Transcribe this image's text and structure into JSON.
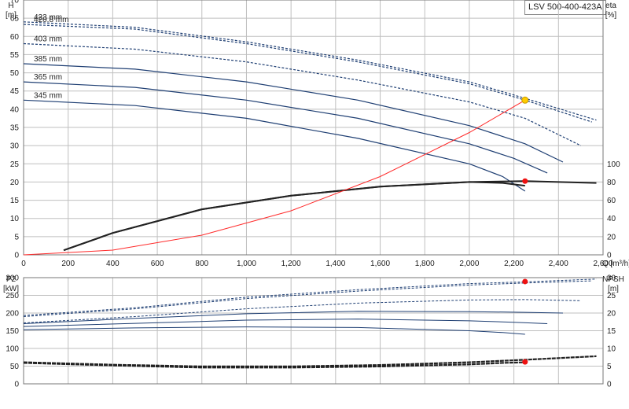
{
  "chart_data": {
    "type": "line",
    "title": "LSV 500-400-423A",
    "q_axis": {
      "label": "Q [m³/h]",
      "min": 0,
      "max": 2600,
      "step": 200
    },
    "top": {
      "left_axis": {
        "label_line1": "H",
        "label_line2": "[m]",
        "min": 0,
        "max": 70,
        "step": 5
      },
      "right_axis": {
        "label_line1": "eta",
        "label_line2": "[%]",
        "min": 0,
        "max": 100,
        "step": 20
      },
      "diameters": [
        "423 mm",
        "420.8 mm",
        "403 mm",
        "385 mm",
        "365 mm",
        "345 mm"
      ],
      "head_curves": [
        {
          "name": "423 mm",
          "q": [
            0,
            500,
            1000,
            1500,
            2000,
            2250,
            2570
          ],
          "h": [
            64,
            62.5,
            58.5,
            53.5,
            47.5,
            43,
            37
          ]
        },
        {
          "name": "420.8 mm",
          "q": [
            0,
            500,
            1000,
            1500,
            2000,
            2250,
            2550
          ],
          "h": [
            63.3,
            62,
            58,
            53,
            47,
            42.5,
            36.5
          ]
        },
        {
          "name": "403 mm",
          "q": [
            0,
            500,
            1000,
            1500,
            2000,
            2250,
            2500
          ],
          "h": [
            58,
            56.5,
            53,
            48,
            42,
            37.5,
            30
          ]
        },
        {
          "name": "385 mm",
          "q": [
            0,
            500,
            1000,
            1500,
            2000,
            2250,
            2420
          ],
          "h": [
            52.5,
            51,
            47.5,
            42.5,
            35.5,
            30.5,
            25.5
          ]
        },
        {
          "name": "365 mm",
          "q": [
            0,
            500,
            1000,
            1500,
            2000,
            2200,
            2350
          ],
          "h": [
            47.5,
            46,
            42.5,
            37.5,
            30.5,
            26.5,
            22.5
          ]
        },
        {
          "name": "345 mm",
          "q": [
            0,
            500,
            1000,
            1500,
            2000,
            2150,
            2250
          ],
          "h": [
            42.5,
            41,
            37.5,
            32,
            25,
            21.5,
            17.5
          ]
        }
      ],
      "system_curve": {
        "q": [
          0,
          400,
          800,
          1200,
          1600,
          2000,
          2250
        ],
        "h": [
          0,
          1.3,
          5.4,
          12.1,
          21.5,
          33.6,
          42.5
        ]
      },
      "efficiency_curves": [
        {
          "name": "423 mm",
          "q": [
            180,
            400,
            800,
            1200,
            1600,
            2000,
            2250,
            2570
          ],
          "eta": [
            5,
            24,
            50,
            65,
            75,
            80,
            81,
            79
          ]
        },
        {
          "name": "345 mm",
          "q": [
            180,
            400,
            800,
            1200,
            1600,
            2000,
            2150,
            2250
          ],
          "eta": [
            5,
            24,
            50,
            65,
            75,
            80,
            79,
            76
          ]
        }
      ],
      "duty_point": {
        "q": 2250,
        "h": 42.5
      },
      "eta_point": {
        "q": 2250,
        "eta": 81
      }
    },
    "bottom": {
      "left_axis": {
        "label_line1": "P2",
        "label_line2": "[kW]",
        "min": 0,
        "max": 300,
        "step": 50
      },
      "right_axis": {
        "label_line1": "NPSH",
        "label_line2": "[m]",
        "min": 0,
        "max": 30,
        "step": 5
      },
      "power_curves": [
        {
          "name": "423 mm",
          "q": [
            0,
            500,
            1000,
            1500,
            2000,
            2250,
            2570
          ],
          "p": [
            193,
            215,
            245,
            266,
            283,
            288,
            296
          ]
        },
        {
          "name": "420.8 mm",
          "q": [
            0,
            500,
            1000,
            1500,
            2000,
            2250,
            2550
          ],
          "p": [
            190,
            212,
            241,
            262,
            279,
            285,
            291
          ]
        },
        {
          "name": "403 mm",
          "q": [
            0,
            500,
            1000,
            1500,
            2000,
            2250,
            2500
          ],
          "p": [
            172,
            190,
            212,
            228,
            237,
            238,
            235
          ]
        },
        {
          "name": "385 mm",
          "q": [
            0,
            500,
            1000,
            1500,
            2000,
            2250,
            2420
          ],
          "p": [
            170,
            185,
            198,
            205,
            204,
            202,
            200
          ]
        },
        {
          "name": "365 mm",
          "q": [
            0,
            500,
            1000,
            1500,
            2000,
            2200,
            2350
          ],
          "p": [
            162,
            171,
            180,
            183,
            178,
            174,
            170
          ]
        },
        {
          "name": "345 mm",
          "q": [
            0,
            500,
            1000,
            1500,
            2000,
            2150,
            2250
          ],
          "p": [
            153,
            158,
            161,
            159,
            150,
            145,
            140
          ]
        }
      ],
      "npsh_curves": [
        {
          "name": "423 mm",
          "q": [
            0,
            400,
            800,
            1200,
            1600,
            2000,
            2250,
            2570
          ],
          "npsh": [
            6.1,
            5.4,
            4.9,
            4.9,
            5.3,
            6.1,
            6.8,
            7.8
          ]
        },
        {
          "name": "345 mm",
          "q": [
            0,
            400,
            800,
            1200,
            1600,
            2000,
            2150,
            2250
          ],
          "npsh": [
            5.9,
            5.2,
            4.6,
            4.6,
            4.9,
            5.5,
            5.9,
            6.1
          ]
        }
      ],
      "power_point": {
        "q": 2250,
        "p": 289
      },
      "npsh_point": {
        "q": 2250,
        "npsh": 6.2
      }
    },
    "colors": {
      "curve": "#1f3f73",
      "system": "#ff2a2a",
      "duty": "#ffcc00",
      "point": "#ee1111",
      "grid": "#bfbfbf",
      "eta": "#222222"
    },
    "grid": true
  }
}
